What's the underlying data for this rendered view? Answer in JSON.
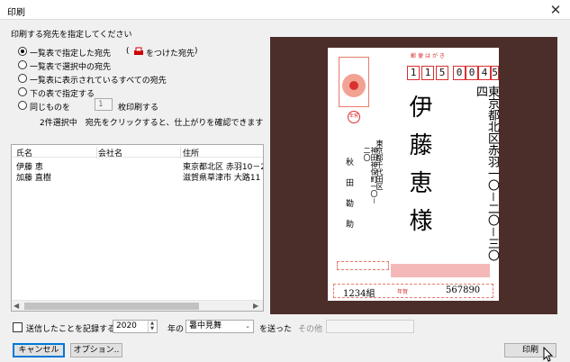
{
  "window": {
    "title": "印刷"
  },
  "prompt": "印刷する宛先を指定してください",
  "options": [
    {
      "label": "一覧表で指定した宛先",
      "selected": true
    },
    {
      "label": "一覧表で選択中の宛先",
      "selected": false
    },
    {
      "label": "一覧表に表示されているすべての宛先",
      "selected": false
    },
    {
      "label": "下の表で指定する",
      "selected": false
    },
    {
      "label": "同じものを",
      "selected": false
    }
  ],
  "marked_note": "をつけた宛先",
  "copies": {
    "value": "1",
    "suffix": "枚印刷する"
  },
  "selection_info": "2件選択中　宛先をクリックすると、仕上がりを確認できます",
  "table": {
    "columns": [
      "氏名",
      "会社名",
      "住所"
    ],
    "rows": [
      {
        "name": "伊藤 恵",
        "company": "",
        "address": "東京都北区 赤羽10－2"
      },
      {
        "name": "加藤 直樹",
        "company": "",
        "address": "滋賀県草津市 大路11"
      }
    ]
  },
  "footer": {
    "record_label": "送信したことを記録する",
    "record_checked": false,
    "year_value": "2020",
    "year_label": "年の",
    "type_value": "暑中見舞",
    "sent_label": "を送った",
    "other_label": "その他",
    "other_value": ""
  },
  "buttons": {
    "cancel": "キャンセル",
    "options": "オプション..",
    "print": "印刷"
  },
  "postcard": {
    "header": "郵便はがき",
    "zip": [
      "1",
      "1",
      "5",
      "0",
      "0",
      "4",
      "5"
    ],
    "recipient_address": "東京都北区赤羽一〇－二〇－三〇四",
    "recipient_name": "伊藤恵様",
    "sender_address1": "東京都千代田区",
    "sender_address2": "神田神保町一〇－二〇",
    "sender_name": "秋田勘助",
    "lottery_group": "1234組",
    "lottery_number": "567890",
    "year_box": "年賀"
  },
  "colors": {
    "preview_bg": "#4b2e2a",
    "postal_red": "#d93030",
    "accent": "#0078d7"
  }
}
